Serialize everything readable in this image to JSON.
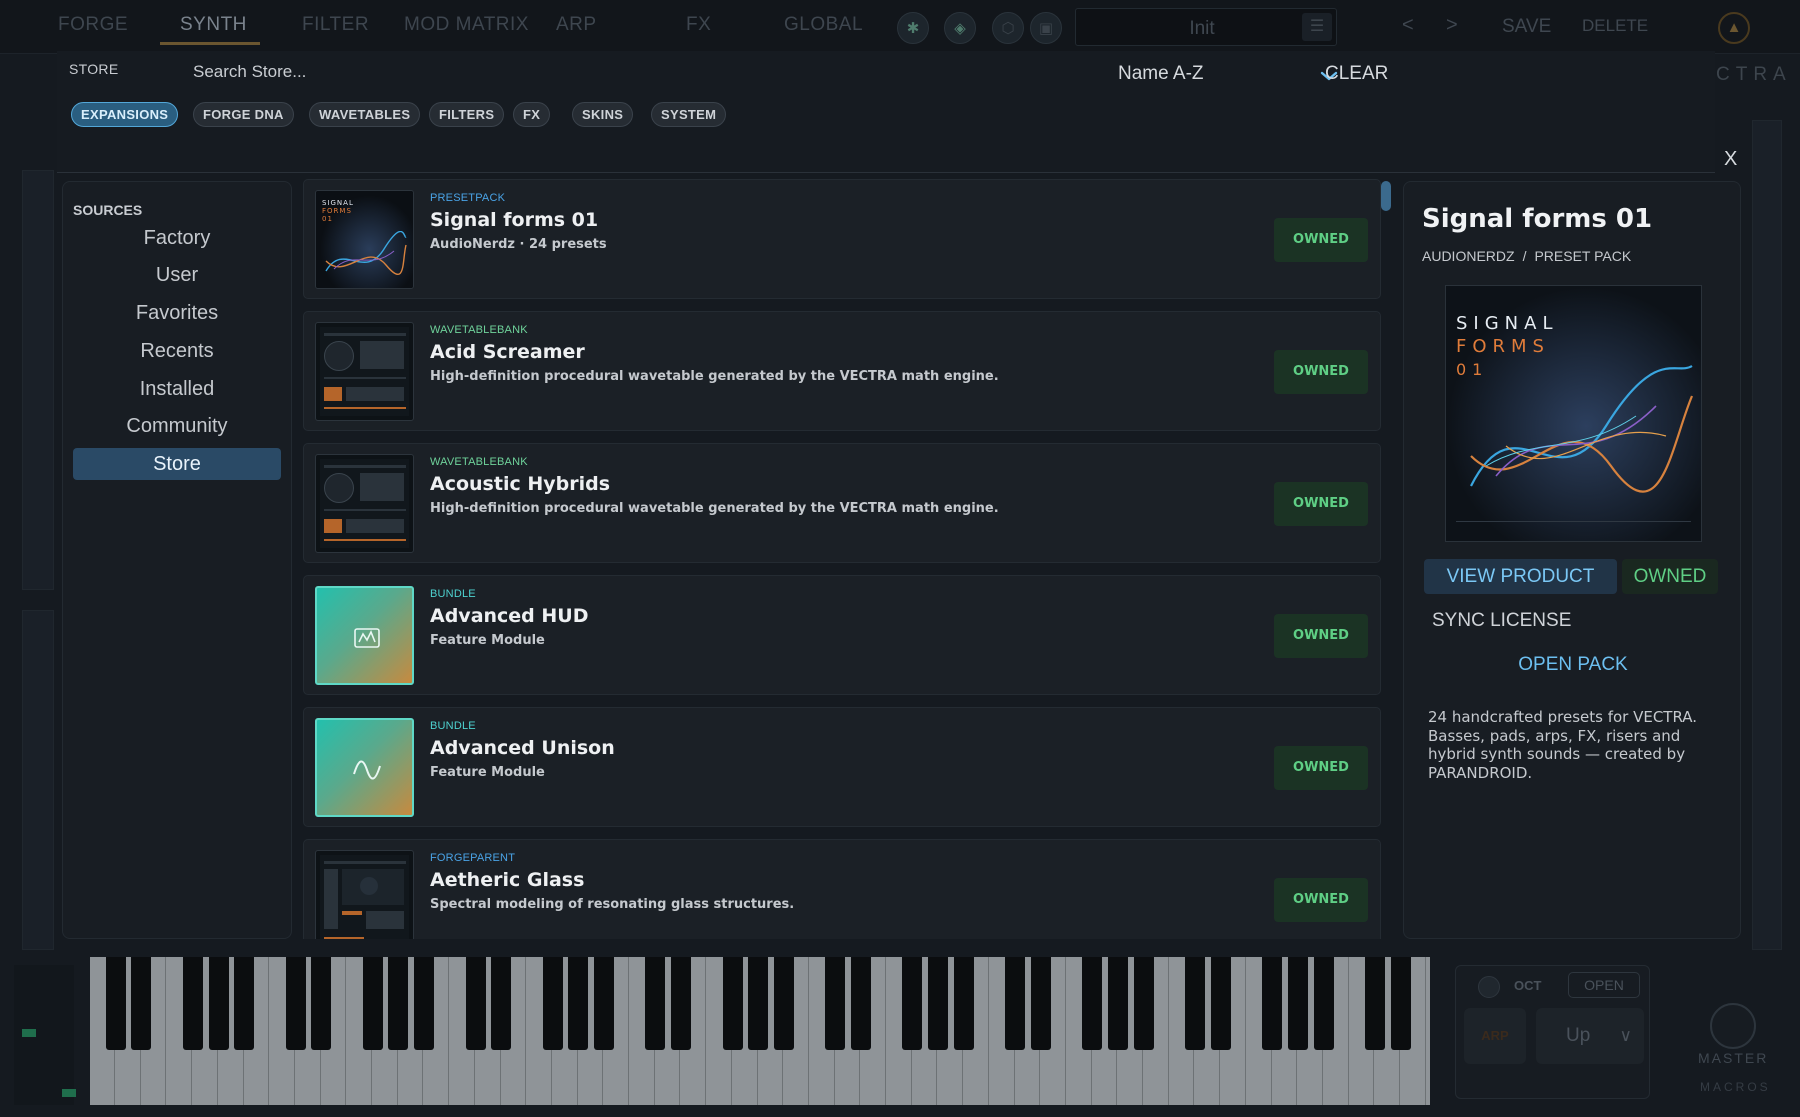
{
  "topbar": {
    "tabs": [
      "FORGE",
      "SYNTH",
      "FILTER",
      "MOD MATRIX",
      "ARP",
      "FX",
      "GLOBAL"
    ],
    "active_tab": "SYNTH",
    "preset_name": "Init",
    "save_label": "SAVE",
    "delete_label": "DELETE",
    "prev_glyph": "<",
    "next_glyph": ">",
    "logo_text": "CTRA"
  },
  "store": {
    "title": "STORE",
    "search_placeholder": "Search Store...",
    "sort_value": "Name A-Z",
    "clear_label": "CLEAR",
    "close_label": "X",
    "chips": [
      {
        "label": "EXPANSIONS",
        "active": true
      },
      {
        "label": "FORGE DNA",
        "active": false
      },
      {
        "label": "WAVETABLES",
        "active": false
      },
      {
        "label": "FILTERS",
        "active": false
      },
      {
        "label": "FX",
        "active": false
      },
      {
        "label": "SKINS",
        "active": false
      },
      {
        "label": "SYSTEM",
        "active": false
      }
    ]
  },
  "sources": {
    "title": "SOURCES",
    "items": [
      "Factory",
      "User",
      "Favorites",
      "Recents",
      "Installed",
      "Community",
      "Store"
    ],
    "selected": "Store"
  },
  "products": [
    {
      "type": "PRESETPACK",
      "title": "Signal forms 01",
      "subtitle": "AudioNerdz  ·  24 presets",
      "status": "OWNED",
      "thumb_text": [
        "SIGNAL",
        "FORMS",
        "01"
      ]
    },
    {
      "type": "WAVETABLEBANK",
      "title": "Acid Screamer",
      "subtitle": "High-definition procedural wavetable generated by the VECTRA math engine.",
      "status": "OWNED"
    },
    {
      "type": "WAVETABLEBANK",
      "title": "Acoustic Hybrids",
      "subtitle": "High-definition procedural wavetable generated by the VECTRA math engine.",
      "status": "OWNED"
    },
    {
      "type": "BUNDLE",
      "title": "Advanced HUD",
      "subtitle": "Feature Module",
      "status": "OWNED",
      "icon": "hud-icon"
    },
    {
      "type": "BUNDLE",
      "title": "Advanced Unison",
      "subtitle": "Feature Module",
      "status": "OWNED",
      "icon": "wave-icon"
    },
    {
      "type": "FORGEPARENT",
      "title": "Aetheric Glass",
      "subtitle": "Spectral modeling of resonating glass structures.",
      "status": "OWNED"
    }
  ],
  "details": {
    "title": "Signal forms 01",
    "vendor": "AUDIONERDZ",
    "separator": "/",
    "kind": "PRESET PACK",
    "cover_text": [
      "SIGNAL",
      "FORMS",
      "01"
    ],
    "view_product_label": "VIEW PRODUCT",
    "owned_label": "OWNED",
    "sync_license_label": "SYNC LICENSE",
    "open_pack_label": "OPEN PACK",
    "description": "24 handcrafted presets for VECTRA. Basses, pads, arps, FX, risers and hybrid synth sounds — created by PARANDROID."
  },
  "bottom": {
    "oct_label": "OCT",
    "open_label": "OPEN",
    "arp_label": "ARP",
    "direction": "Up",
    "master_label": "MASTER",
    "macros_label": "MACROS"
  },
  "colors": {
    "accent_blue": "#53a7d8",
    "owned_green": "#5fcf85",
    "selected_bg": "#2a4a66"
  }
}
